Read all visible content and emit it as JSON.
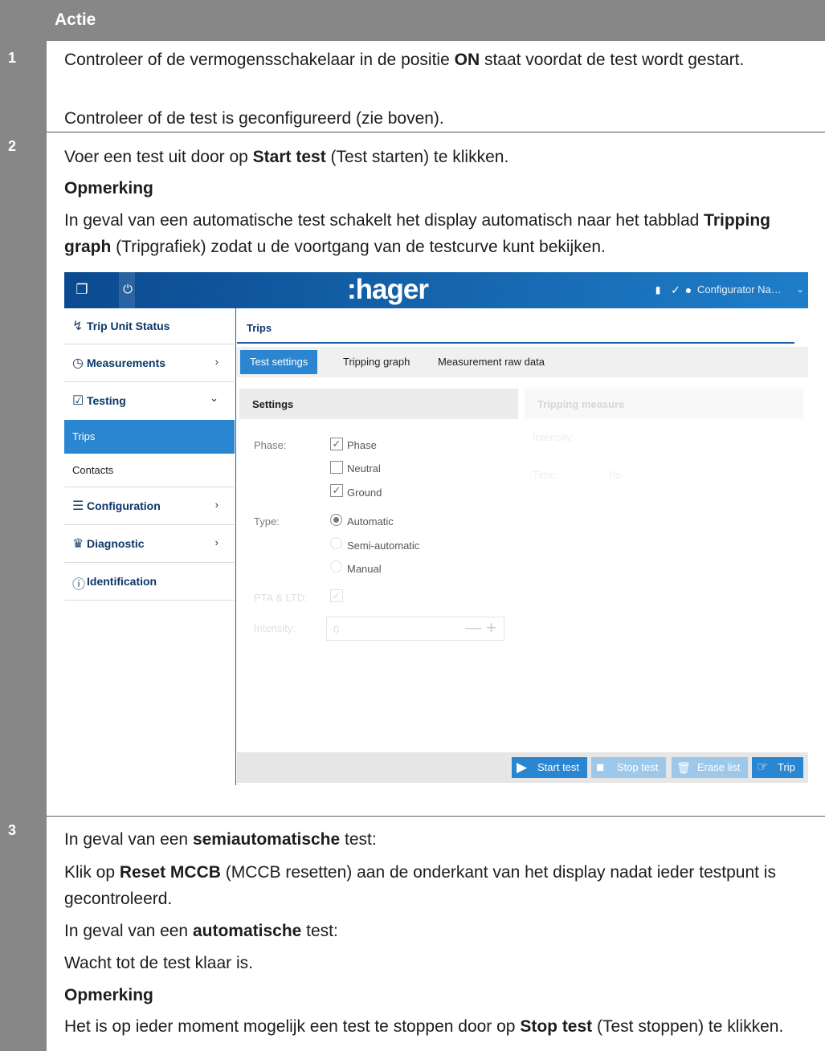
{
  "table": {
    "header": "Actie",
    "row1": {
      "num": "1",
      "p1_a": "Controleer of de vermogensschakelaar in de positie ",
      "p1_b": "ON",
      "p1_c": " staat voordat de test wordt gestart.",
      "p2": "Controleer of de test is geconfigureerd (zie boven)."
    },
    "row2": {
      "num": "2",
      "p1_a": "Voer een test uit door op ",
      "p1_b": "Start test",
      "p1_c": " (Test starten) te klikken.",
      "note_heading": "Opmerking",
      "p2_a": "In geval van een automatische test schakelt het display automatisch naar het tabblad ",
      "p2_b": "Tripping graph",
      "p2_c": " (Tripgrafiek) zodat u de voortgang van de testcurve kunt bekijken."
    },
    "row3": {
      "num": "3",
      "p1_a": "In geval van een ",
      "p1_b": "semiautomatische",
      "p1_c": " test:",
      "p2_a": "Klik op ",
      "p2_b": "Reset MCCB",
      "p2_c": " (MCCB resetten) aan de onderkant van het display nadat ieder testpunt is gecontroleerd.",
      "p3_a": "In geval van een ",
      "p3_b": "automatische",
      "p3_c": " test:",
      "p4": "Wacht tot de test klaar is.",
      "note_heading": "Opmerking",
      "p5_a": "Het is op ieder moment mogelijk een test te stoppen door op ",
      "p5_b": "Stop test",
      "p5_c": " (Test stoppen) te klikken."
    }
  },
  "app": {
    "logo": ":hager",
    "user": "Configurator Na…",
    "icons": {
      "home": "cube-icon",
      "power": "power-icon",
      "battery": "battery-icon",
      "check": "check-circle-icon",
      "user": "user-icon",
      "chevron": "chevron-down-icon"
    },
    "sidebar": {
      "trip_unit_status": "Trip Unit Status",
      "measurements": "Measurements",
      "testing": "Testing",
      "trips": "Trips",
      "contacts": "Contacts",
      "configuration": "Configuration",
      "diagnostic": "Diagnostic",
      "identification": "Identification"
    },
    "main": {
      "title": "Trips",
      "tabs": [
        "Test settings",
        "Tripping graph",
        "Measurement raw data"
      ],
      "settings_head": "Settings",
      "tripping_head": "Tripping measure",
      "phase_label": "Phase:",
      "phase_opts": [
        "Phase",
        "Neutral",
        "Ground"
      ],
      "type_label": "Type:",
      "type_opts": [
        "Automatic",
        "Semi-automatic",
        "Manual"
      ],
      "pta_label": "PTA & LTD:",
      "intensity_label": "Intensity:",
      "intensity_value": "0",
      "tm_intensity": "Intensity:",
      "tm_time": "Time:",
      "tm_time_value": "0s",
      "buttons": {
        "start": "Start test",
        "stop": "Stop test",
        "erase": "Erase list",
        "trip": "Trip"
      }
    },
    "colors": {
      "accent": "#2a86d0",
      "brand_dark": "#0b3768",
      "header_grey": "#878787"
    }
  }
}
